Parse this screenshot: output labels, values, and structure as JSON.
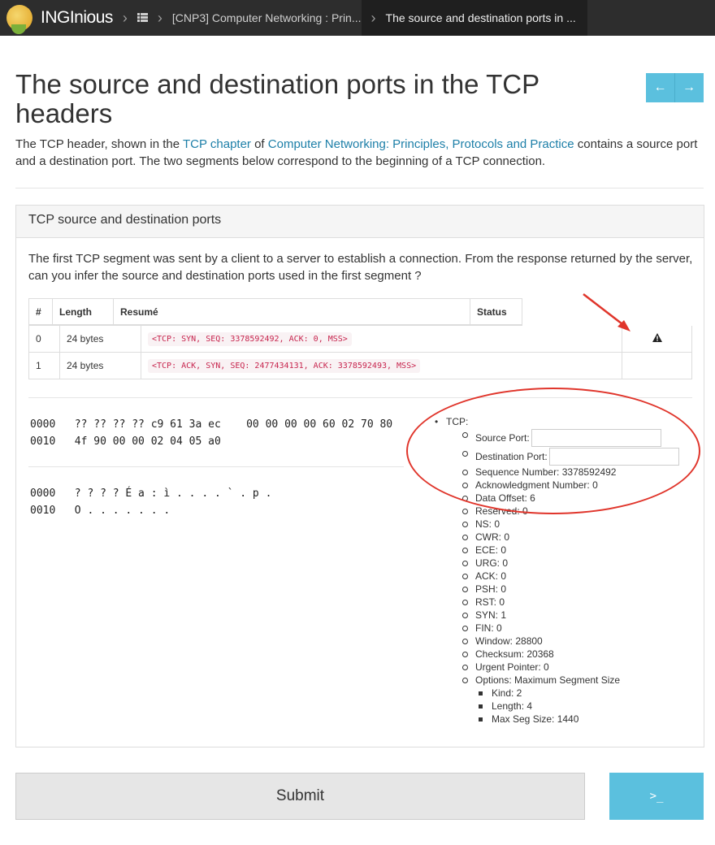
{
  "navbar": {
    "brand": "INGInious",
    "course_crumb": "[CNP3] Computer Networking : Prin...",
    "task_crumb": "The source and destination ports in ...",
    "icons": {
      "courses": "list-icon",
      "separator": "chevron-right-icon"
    }
  },
  "page": {
    "title": "The source and destination ports in the TCP headers",
    "intro": {
      "part1": "The TCP header, shown in the ",
      "link1": "TCP chapter",
      "part2": " of ",
      "link2": "Computer Networking: Principles, Protocols and Practice",
      "part3": " contains a source port and a destination port. The two segments below correspond to the beginning of a TCP connection."
    },
    "pager": {
      "prev_icon": "arrow-left-icon",
      "next_icon": "arrow-right-icon"
    }
  },
  "panel": {
    "heading": "TCP source and destination ports",
    "question": "The first TCP segment was sent by a client to a server to establish a connection. From the response returned by the server, can you infer the source and destination ports used in the first segment ?",
    "table": {
      "headers": [
        "#",
        "Length",
        "Resumé",
        "Status"
      ],
      "rows": [
        {
          "num": "0",
          "length": "24 bytes",
          "summary": "<TCP: SYN, SEQ: 3378592492, ACK: 0, MSS>",
          "status": "warning-icon"
        },
        {
          "num": "1",
          "length": "24 bytes",
          "summary": "<TCP: ACK, SYN, SEQ: 2477434131, ACK: 3378592493, MSS>",
          "status": ""
        }
      ]
    },
    "hexdump": {
      "line1": "0000   ?? ?? ?? ?? c9 61 3a ec    00 00 00 00 60 02 70 80",
      "line2": "0010   4f 90 00 00 02 04 05 a0",
      "ascii1": "0000   ? ? ? ? É a : ì . . . . ` . p .",
      "ascii2": "0010   O . . . . . . ."
    },
    "tcp": {
      "root": "TCP:",
      "source_port_label": "Source Port:",
      "source_port_value": "",
      "destination_port_label": "Destination Port:",
      "destination_port_value": "",
      "fields": [
        "Sequence Number: 3378592492",
        "Acknowledgment Number: 0",
        "Data Offset: 6",
        "Reserved: 0",
        "NS: 0",
        "CWR: 0",
        "ECE: 0",
        "URG: 0",
        "ACK: 0",
        "PSH: 0",
        "RST: 0",
        "SYN: 1",
        "FIN: 0",
        "Window: 28800",
        "Checksum: 20368",
        "Urgent Pointer: 0",
        "Options: Maximum Segment Size"
      ],
      "options": [
        "Kind: 2",
        "Length: 4",
        "Max Seg Size: 1440"
      ]
    }
  },
  "buttons": {
    "submit": "Submit",
    "console": ">_"
  },
  "colors": {
    "navbar": "#2d2d2d",
    "accent": "#5bc0de",
    "link": "#1d7fa8",
    "code": "#c7254e",
    "annotation": "#e0352b"
  }
}
